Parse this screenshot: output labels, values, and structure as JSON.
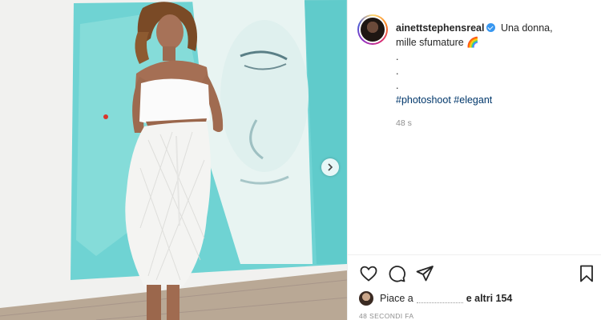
{
  "post": {
    "username": "ainettstephensreal",
    "caption_line1": "Una donna,",
    "caption_line2": "mille sfumature",
    "caption_emoji": "🌈",
    "dots": [
      ".",
      ".",
      "."
    ],
    "hashtags": "#photoshoot #elegant",
    "caption_time": "48 s",
    "likes_prefix": "Piace a",
    "likes_suffix": "e altri 154",
    "posted_ago": "48 SECONDI FA"
  },
  "icons": {
    "like": "heart-icon",
    "comment": "comment-icon",
    "share": "paper-plane-icon",
    "save": "bookmark-icon",
    "next": "chevron-right-icon",
    "verified": "verified-badge-icon"
  },
  "colors": {
    "link": "#00376b",
    "verified": "#3897f0",
    "muted": "#8e8e8e"
  }
}
